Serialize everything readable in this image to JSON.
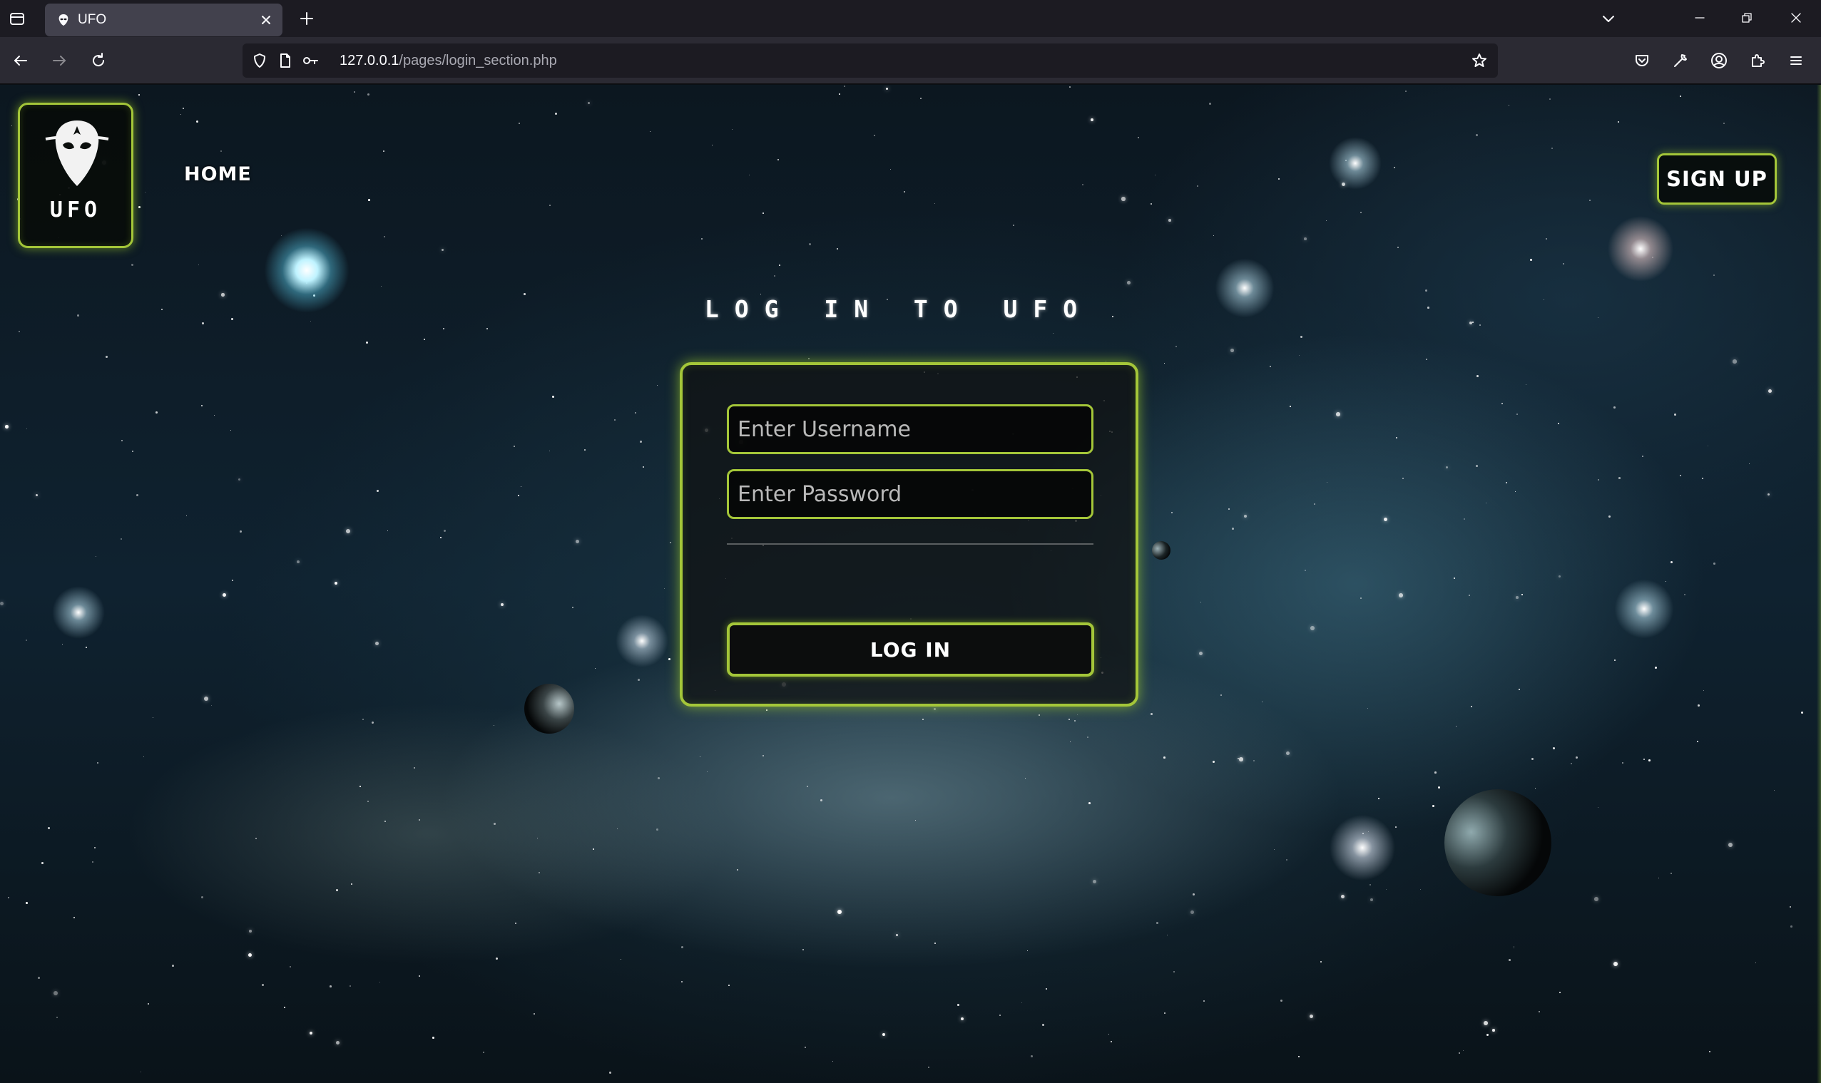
{
  "browser": {
    "tab": {
      "title": "UFO"
    },
    "url": {
      "host": "127.0.0.1",
      "path": "/pages/login_section.php"
    },
    "icons": {
      "tab_list": "tab-list-icon",
      "favicon": "alien-favicon-icon",
      "tab_close": "close-icon",
      "new_tab": "plus-icon",
      "list_all_tabs": "chevron-down-icon",
      "minimize": "minimize-icon",
      "restore": "restore-icon",
      "close_window": "close-icon",
      "back": "back-arrow-icon",
      "forward": "forward-arrow-icon",
      "reload": "reload-icon",
      "tracking_protection": "shield-icon",
      "page_info": "page-icon",
      "permissions": "key-icon",
      "bookmark": "star-icon",
      "pocket": "pocket-icon",
      "tools": "wrench-icon",
      "account": "account-icon",
      "extensions": "puzzle-icon",
      "menu": "hamburger-menu-icon"
    }
  },
  "page": {
    "logo": {
      "text": "UFO",
      "icon": "alien-head-icon"
    },
    "nav": {
      "home": "HOME"
    },
    "signup": {
      "label": "SIGN UP"
    },
    "login": {
      "title": "LOG IN TO UFO",
      "username_placeholder": "Enter Username",
      "password_placeholder": "Enter Password",
      "submit_label": "LOG IN"
    },
    "colors": {
      "accent": "#a4c639",
      "card_bg": "#101212",
      "chrome_dark": "#1c1b22",
      "chrome_bar": "#2b2a33"
    }
  }
}
